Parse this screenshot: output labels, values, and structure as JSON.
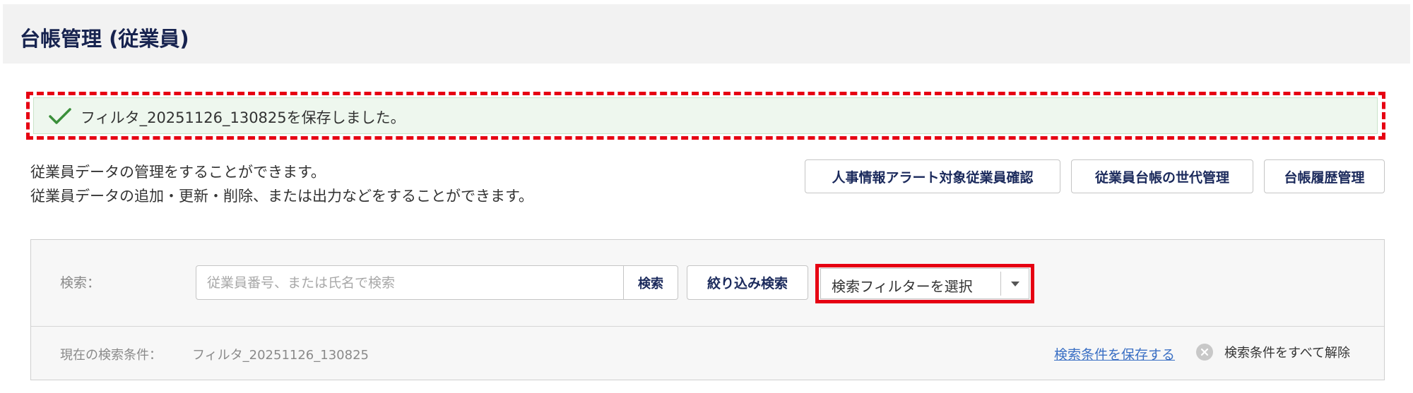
{
  "header": {
    "title": "台帳管理 (従業員)"
  },
  "toast": {
    "message": "フィルタ_20251126_130825を保存しました。",
    "icon": "check-icon"
  },
  "description": {
    "line1": "従業員データの管理をすることができます。",
    "line2": "従業員データの追加・更新・削除、または出力などをすることができます。"
  },
  "actions": {
    "alert_label": "人事情報アラート対象従業員確認",
    "generation_label": "従業員台帳の世代管理",
    "history_label": "台帳履歴管理"
  },
  "search": {
    "label": "検索：",
    "placeholder": "従業員番号、または氏名で検索",
    "value": "",
    "submit_label": "検索",
    "narrow_label": "絞り込み検索",
    "filter_select_value": "検索フィルターを選択"
  },
  "conditions": {
    "label": "現在の検索条件：",
    "value": "フィルタ_20251126_130825",
    "save_link": "検索条件を保存する",
    "clear_label": "検索条件をすべて解除"
  },
  "colors": {
    "title": "#17234f",
    "highlight": "#e60012",
    "success_bg": "#eef7ee",
    "success_icon": "#3a8f3a",
    "link": "#3a6fc4"
  }
}
